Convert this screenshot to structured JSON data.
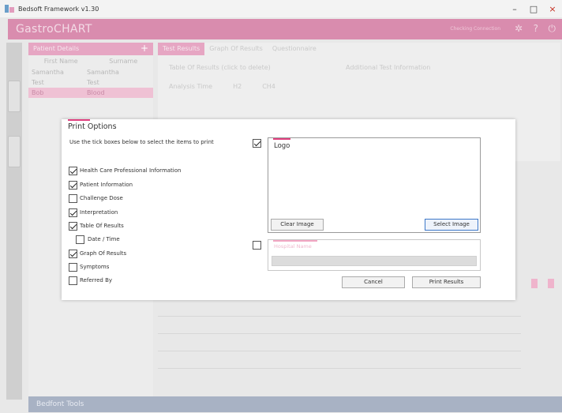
{
  "window": {
    "title": "Bedsoft Framework v1.30",
    "minimize": "–",
    "maximize": "□",
    "close": "×"
  },
  "app": {
    "logo": "GastroCHART",
    "header_hint": "Checking Connection",
    "patient_panel": {
      "title": "Patient Details",
      "columns": [
        "First Name",
        "Surname"
      ],
      "rows": [
        {
          "first": "Samantha",
          "last": "Samantha"
        },
        {
          "first": "Test",
          "last": "Test"
        },
        {
          "first": "Bob",
          "last": "Blood"
        }
      ]
    },
    "tabs": [
      "Test Results",
      "Graph Of Results",
      "Questionnaire"
    ],
    "results_caption": "Table Of Results (click to delete)",
    "results_header": [
      "Analysis Time",
      "H2",
      "CH4"
    ],
    "additional_info_title": "Additional Test Information",
    "bottom_bar": "Bedfont Tools"
  },
  "dialog": {
    "title": "Print Options",
    "instructions": "Use the tick boxes below to select the items to print",
    "items": [
      {
        "label": "Health Care Professional Information",
        "checked": true
      },
      {
        "label": "Patient Information",
        "checked": true
      },
      {
        "label": "Challenge Dose",
        "checked": false
      },
      {
        "label": "Interpretation",
        "checked": true
      },
      {
        "label": "Table Of Results",
        "checked": true
      },
      {
        "label": "Date / Time",
        "checked": false
      },
      {
        "label": "Graph Of Results",
        "checked": true
      },
      {
        "label": "Symptoms",
        "checked": false
      },
      {
        "label": "Referred By",
        "checked": false
      }
    ],
    "logo_checked": true,
    "logo_label": "Logo",
    "clear_image": "Clear Image",
    "select_image": "Select Image",
    "hospital_checked": false,
    "hospital_label": "Hospital Name",
    "cancel": "Cancel",
    "print_results": "Print Results"
  }
}
